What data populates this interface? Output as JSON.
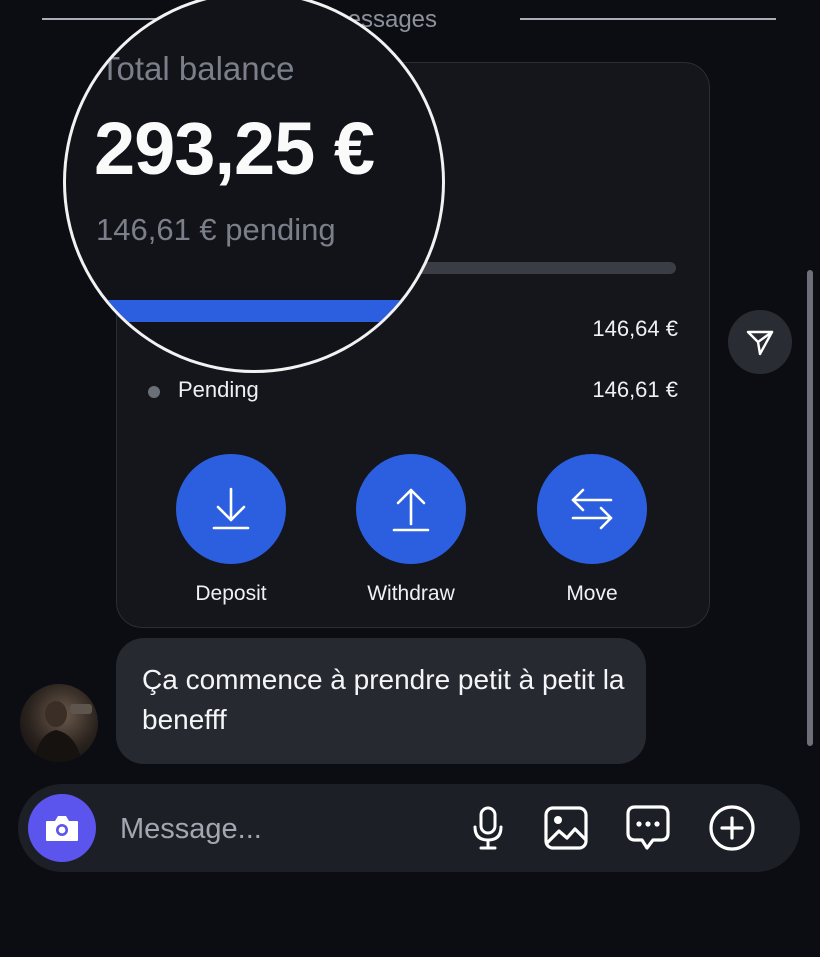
{
  "divider": {
    "text": "New messages"
  },
  "card": {
    "rows": [
      {
        "label": "",
        "amount": "146,64 €"
      },
      {
        "label": "Pending",
        "amount": "146,61 €"
      }
    ],
    "actions": [
      {
        "label": "Deposit",
        "icon": "download-icon"
      },
      {
        "label": "Withdraw",
        "icon": "upload-icon"
      },
      {
        "label": "Move",
        "icon": "swap-arrows-icon"
      }
    ],
    "progress_fraction": 0.5
  },
  "magnifier": {
    "title": "Total balance",
    "amount": "293,25 €",
    "pending": "146,61 € pending"
  },
  "message": {
    "text": "Ça commence à prendre petit à petit la benefff"
  },
  "composer": {
    "placeholder": "Message...",
    "icons": [
      "camera-icon",
      "microphone-icon",
      "image-icon",
      "message-dots-icon",
      "plus-circle-icon"
    ]
  },
  "colors": {
    "background": "#0b0d13",
    "accent_blue": "#2b5fe0",
    "camera_purple": "#5b55ee",
    "bubble": "#272930"
  }
}
